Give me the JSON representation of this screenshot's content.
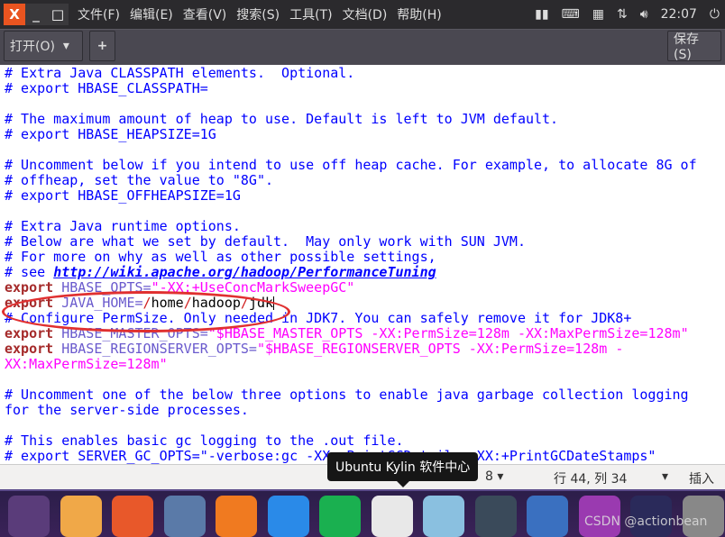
{
  "window": {
    "close": "X",
    "minimize": "_",
    "maximize": "□"
  },
  "menu": [
    "文件(F)",
    "编辑(E)",
    "查看(V)",
    "搜索(S)",
    "工具(T)",
    "文档(D)",
    "帮助(H)"
  ],
  "tray": {
    "icons": [
      "input-method-icon",
      "keyboard-icon",
      "calendar-icon",
      "network-icon",
      "volume-icon"
    ],
    "clock": "22:07",
    "power": "⏻"
  },
  "toolbar": {
    "open": "打开(O)",
    "open_arrow": "▾",
    "new_tab": "+",
    "save": "保存(S)"
  },
  "editor": {
    "lines": [
      [
        [
          "c",
          "# Extra Java CLASSPATH elements.  Optional."
        ]
      ],
      [
        [
          "c",
          "# export HBASE_CLASSPATH="
        ]
      ],
      [],
      [
        [
          "c",
          "# The maximum amount of heap to use. Default is left to JVM default."
        ]
      ],
      [
        [
          "c",
          "# export HBASE_HEAPSIZE=1G"
        ]
      ],
      [],
      [
        [
          "c",
          "# Uncomment below if you intend to use off heap cache. For example, to allocate 8G of"
        ]
      ],
      [
        [
          "c",
          "# offheap, set the value to \"8G\"."
        ]
      ],
      [
        [
          "c",
          "# export HBASE_OFFHEAPSIZE=1G"
        ]
      ],
      [],
      [
        [
          "c",
          "# Extra Java runtime options."
        ]
      ],
      [
        [
          "c",
          "# Below are what we set by default.  May only work with SUN JVM."
        ]
      ],
      [
        [
          "c",
          "# For more on why as well as other possible settings,"
        ]
      ],
      [
        [
          "c",
          "# see "
        ],
        [
          "u",
          "http://wiki.apache.org/hadoop/PerformanceTuning"
        ]
      ],
      [
        [
          "k",
          "export"
        ],
        [
          "v",
          " HBASE_OPTS="
        ],
        [
          "s",
          "\"-XX:+UseConcMarkSweepGC\""
        ]
      ],
      [
        [
          "k",
          "export"
        ],
        [
          "v",
          " JAVA_HOME="
        ],
        [
          "r",
          "/"
        ],
        [
          "",
          "home"
        ],
        [
          "r",
          "/"
        ],
        [
          "",
          "hadoop"
        ],
        [
          "r",
          "/"
        ],
        [
          "",
          "jdk"
        ]
      ],
      [
        [
          "c",
          "# Configure PermSize. Only needed in JDK7. You can safely remove it for JDK8+"
        ]
      ],
      [
        [
          "k",
          "export"
        ],
        [
          "v",
          " HBASE_MASTER_OPTS="
        ],
        [
          "s",
          "\"$HBASE_MASTER_OPTS -XX:PermSize=128m -XX:MaxPermSize=128m\""
        ]
      ],
      [
        [
          "k",
          "export"
        ],
        [
          "v",
          " HBASE_REGIONSERVER_OPTS="
        ],
        [
          "s",
          "\"$HBASE_REGIONSERVER_OPTS -XX:PermSize=128m -"
        ]
      ],
      [
        [
          "s",
          "XX:MaxPermSize=128m\""
        ]
      ],
      [],
      [
        [
          "c",
          "# Uncomment one of the below three options to enable java garbage collection logging"
        ]
      ],
      [
        [
          "c",
          "for the server-side processes."
        ]
      ],
      [],
      [
        [
          "c",
          "# This enables basic gc logging to the .out file."
        ]
      ],
      [
        [
          "c",
          "# export SERVER_GC_OPTS=\"-verbose:gc -XX:+PrintGCDetails -XX:+PrintGCDateStamps\""
        ]
      ]
    ],
    "cursor_line": 15,
    "colors": {
      "comment": "#0000ff",
      "keyword": "#a52a2a",
      "variable": "#6a5acd",
      "string": "#ff00ff",
      "annotation": "#e03030"
    }
  },
  "status": {
    "tab_width": "8 ▾",
    "position": "行 44, 列 34",
    "mode_arrow": "▾",
    "mode": "插入"
  },
  "tooltip": "Ubuntu Kylin 软件中心",
  "dock": [
    {
      "name": "ubuntu-dash-icon",
      "color": "#5a3c7a"
    },
    {
      "name": "files-icon",
      "color": "#f0a848"
    },
    {
      "name": "firefox-icon",
      "color": "#e8582a"
    },
    {
      "name": "chromium-icon",
      "color": "#5a7aa8"
    },
    {
      "name": "wps-presentation-icon",
      "color": "#f07a20"
    },
    {
      "name": "wps-writer-icon",
      "color": "#2a8ae8"
    },
    {
      "name": "wps-spreadsheet-icon",
      "color": "#1ab050"
    },
    {
      "name": "kylin-software-center-icon",
      "color": "#e8e8e8"
    },
    {
      "name": "update-manager-icon",
      "color": "#8ac0e0"
    },
    {
      "name": "terminal-icon",
      "color": "#3a4a5a"
    },
    {
      "name": "app-launcher-icon",
      "color": "#3a70c0"
    },
    {
      "name": "text-editor-icon",
      "color": "#9a3ab0"
    },
    {
      "name": "eclipse-icon",
      "color": "#2a2a5a"
    },
    {
      "name": "trash-icon",
      "color": "#888"
    }
  ],
  "watermark": "CSDN @actionbean"
}
